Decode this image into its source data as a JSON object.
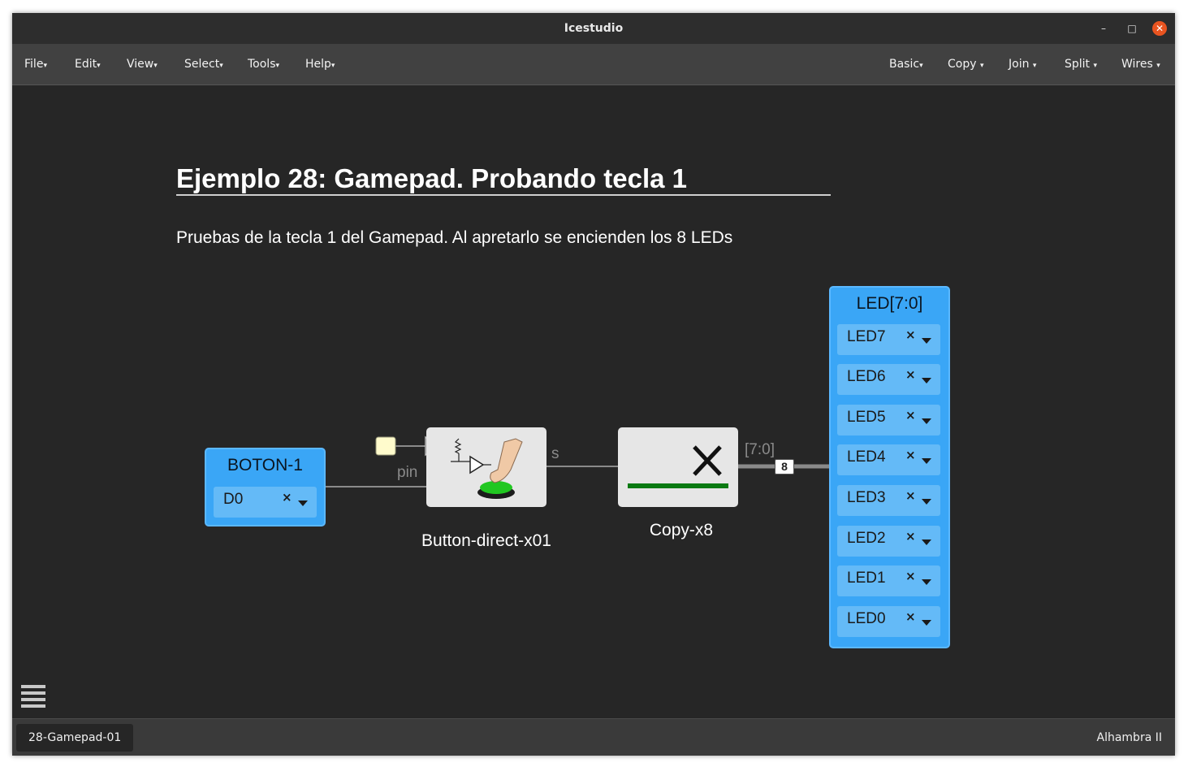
{
  "window": {
    "title": "Icestudio",
    "minimize": "–",
    "maximize": "□",
    "close": "✕"
  },
  "menu_left": [
    {
      "label": "File"
    },
    {
      "label": "Edit"
    },
    {
      "label": "View"
    },
    {
      "label": "Select"
    },
    {
      "label": "Tools"
    },
    {
      "label": "Help"
    }
  ],
  "menu_right": [
    {
      "label": "Basic"
    },
    {
      "label": "Copy"
    },
    {
      "label": "Join"
    },
    {
      "label": "Split"
    },
    {
      "label": "Wires"
    }
  ],
  "canvas": {
    "heading": "Ejemplo 28: Gamepad. Probando tecla 1",
    "description": "Pruebas de la tecla 1 del Gamepad. Al apretarlo se encienden los 8 LEDs",
    "input_block": {
      "name": "BOTON-1",
      "pin": "D0"
    },
    "button_block": {
      "name": "Button-direct-x01",
      "input_port": "pin",
      "output_port": "s"
    },
    "copy_block": {
      "name": "Copy-x8",
      "output_port": "[7:0]"
    },
    "bus_width": "8",
    "output_block": {
      "name": "LED[7:0]",
      "pins": [
        "LED7",
        "LED6",
        "LED5",
        "LED4",
        "LED3",
        "LED2",
        "LED1",
        "LED0"
      ]
    },
    "pin_remove_glyph": "×"
  },
  "statusbar": {
    "file": "28-Gamepad-01",
    "board": "Alhambra II"
  },
  "colors": {
    "io_block": "#3aa6f6",
    "pin_box": "#64baf7",
    "canvas": "#262626",
    "close": "#e95420",
    "copy_bar": "#0a7a12"
  }
}
